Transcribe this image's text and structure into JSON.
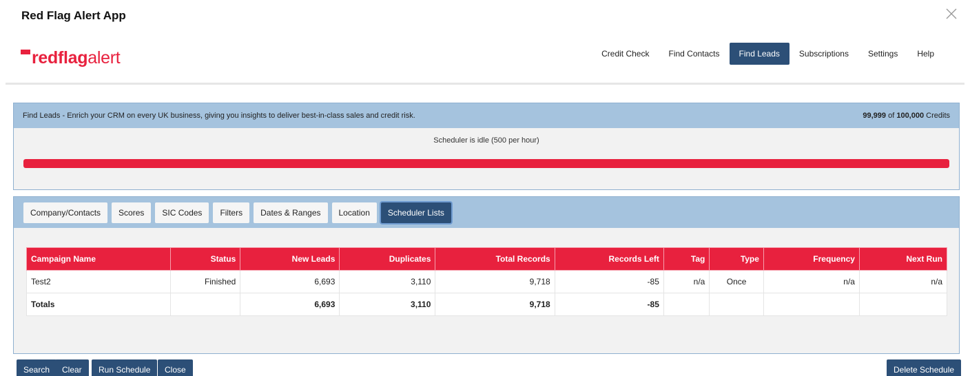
{
  "app": {
    "title": "Red Flag Alert App"
  },
  "logo": {
    "part1": "redflag",
    "part2": "alert"
  },
  "nav": [
    {
      "label": "Credit Check",
      "active": false
    },
    {
      "label": "Find Contacts",
      "active": false
    },
    {
      "label": "Find Leads",
      "active": true
    },
    {
      "label": "Subscriptions",
      "active": false
    },
    {
      "label": "Settings",
      "active": false
    },
    {
      "label": "Help",
      "active": false
    }
  ],
  "info": {
    "description": "Find Leads - Enrich your CRM on every UK business, giving you insights to deliver best-in-class sales and credit risk.",
    "credits_used": "99,999",
    "credits_of": "of",
    "credits_total": "100,000",
    "credits_label": "Credits"
  },
  "scheduler": {
    "status": "Scheduler is idle (500 per hour)",
    "progress": 1.0
  },
  "tabs": [
    {
      "label": "Company/Contacts",
      "active": false
    },
    {
      "label": "Scores",
      "active": false
    },
    {
      "label": "SIC Codes",
      "active": false
    },
    {
      "label": "Filters",
      "active": false
    },
    {
      "label": "Dates & Ranges",
      "active": false
    },
    {
      "label": "Location",
      "active": false
    },
    {
      "label": "Scheduler Lists",
      "active": true
    }
  ],
  "table": {
    "headers": [
      "Campaign Name",
      "Status",
      "New Leads",
      "Duplicates",
      "Total Records",
      "Records Left",
      "Tag",
      "Type",
      "Frequency",
      "Next Run"
    ],
    "rows": [
      [
        "Test2",
        "Finished",
        "6,693",
        "3,110",
        "9,718",
        "-85",
        "n/a",
        "Once",
        "n/a",
        "n/a"
      ]
    ],
    "totals": [
      "Totals",
      "",
      "6,693",
      "3,110",
      "9,718",
      "-85",
      "",
      "",
      "",
      ""
    ]
  },
  "buttons": {
    "search": "Search",
    "clear": "Clear",
    "run_schedule": "Run Schedule",
    "close": "Close",
    "delete_schedule": "Delete Schedule"
  },
  "colors": {
    "brand_red": "#e8213e",
    "nav_active": "#2c4f77",
    "panel_header": "#a5c3de"
  }
}
